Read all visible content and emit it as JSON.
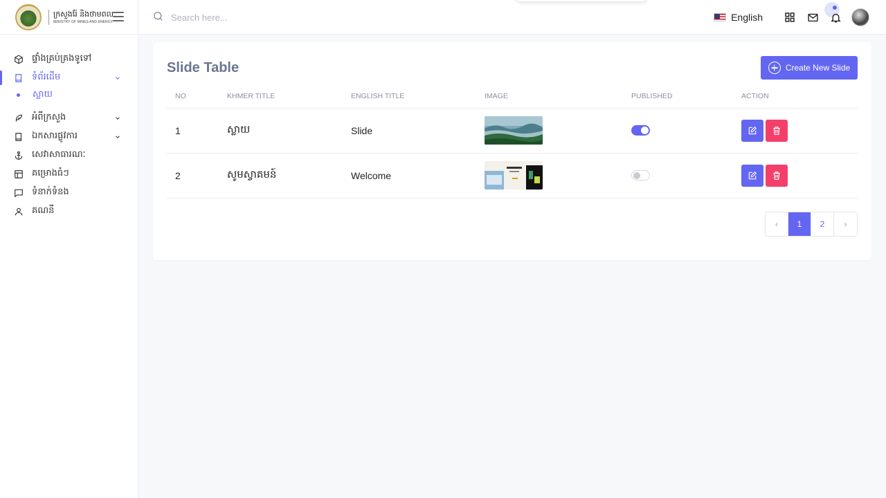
{
  "brand": {
    "name_kh": "ក្រសួងរ៉ែ និងថាមពល",
    "name_en": "MINISTRY OF MINES AND ENERGY"
  },
  "sidebar": {
    "items": [
      {
        "label": "ផ្ទាំងគ្រប់គ្រងទូទៅ",
        "icon": "cube-icon"
      },
      {
        "label": "ទំព័រដើម",
        "icon": "book-icon",
        "active": true,
        "expanded": true
      },
      {
        "label": "អំពីក្រសួង",
        "icon": "feather-icon"
      },
      {
        "label": "ឯកសារផ្លូវការ",
        "icon": "book-icon"
      },
      {
        "label": "សេវាសាធារណៈ",
        "icon": "anchor-icon"
      },
      {
        "label": "គម្រោងធំៗ",
        "icon": "layout-icon"
      },
      {
        "label": "ទំនាក់ទំនង",
        "icon": "message-icon"
      },
      {
        "label": "គណនី",
        "icon": "user-icon"
      }
    ],
    "subitems": [
      {
        "label": "ស្លាយ",
        "active": true
      }
    ]
  },
  "header": {
    "search_placeholder": "Search here...",
    "language": "English"
  },
  "main": {
    "title": "Slide Table",
    "create_button": "Create New Slide",
    "columns": [
      "NO",
      "KHMER TITLE",
      "ENGLISH TITLE",
      "IMAGE",
      "PUBLISHED",
      "ACTION"
    ],
    "rows": [
      {
        "no": "1",
        "khmer_title": "ស្លាយ",
        "english_title": "Slide",
        "published": true
      },
      {
        "no": "2",
        "khmer_title": "សូមស្វាគមន៍",
        "english_title": "Welcome",
        "published": false
      }
    ],
    "pagination": {
      "prev": "‹",
      "pages": [
        "1",
        "2"
      ],
      "current": "1",
      "next": "›"
    }
  },
  "colors": {
    "accent": "#6366f1",
    "danger": "#f43f6a",
    "background": "#f7f8fa"
  }
}
